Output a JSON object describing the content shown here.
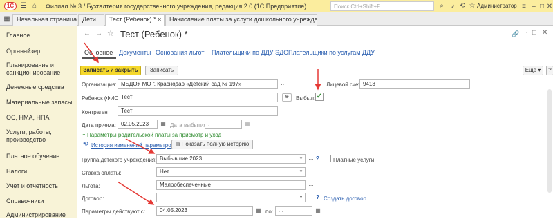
{
  "app": {
    "logo_text": "1С",
    "title": "Филиал № 3 / Бухгалтерия государственного учреждения, редакция 2.0  (1С:Предприятие)",
    "search_placeholder": "Поиск Ctrl+Shift+F",
    "user_name": "Администратор"
  },
  "tabs": [
    {
      "label": "Начальная страница"
    },
    {
      "label": "Дети"
    },
    {
      "label": "Тест (Ребенок) *"
    },
    {
      "label": "Начисление платы за услуги дошкольного учреждения"
    }
  ],
  "sidebar": {
    "items": [
      {
        "label": "Главное"
      },
      {
        "label": "Органайзер"
      },
      {
        "label": "Планирование и санкционирование"
      },
      {
        "label": "Денежные средства"
      },
      {
        "label": "Материальные запасы"
      },
      {
        "label": "ОС, НМА, НПА"
      },
      {
        "label": "Услуги, работы, производство"
      },
      {
        "label": "Платное обучение"
      },
      {
        "label": "Налоги"
      },
      {
        "label": "Учет и отчетность"
      },
      {
        "label": "Справочники"
      },
      {
        "label": "Администрирование"
      }
    ]
  },
  "form": {
    "title": "Тест (Ребенок) *",
    "subtabs": [
      {
        "label": "Основное"
      },
      {
        "label": "Документы"
      },
      {
        "label": "Основания льгот"
      },
      {
        "label": "Плательщики по ДДУ ЭДО"
      },
      {
        "label": "Плательщики по услугам ДДУ"
      }
    ],
    "save_close": "Записать и закрыть",
    "save": "Записать",
    "more": "Еще",
    "help": "?",
    "org_label": "Организация:",
    "org_value": "МБДОУ  МО г. Краснодар «Детский сад № 197»",
    "account_label": "Лицевой счет:",
    "account_value": "9413",
    "child_label": "Ребенок (ФИО):",
    "child_value": "Тест",
    "left_label": "Выбыл:",
    "contractor_label": "Контрагент:",
    "contractor_value": "Тест",
    "admission_label": "Дата приема:",
    "admission_value": "02.05.2023",
    "leave_label": "Дата выбытия:",
    "leave_value": ".  .",
    "params_header": "Параметры родительской платы за присмотр и уход",
    "history_link": "История изменений параметров",
    "history_btn": "Показать полную историю",
    "group_label": "Группа детского учреждения:",
    "group_value": "Выбывшие 2023",
    "paid_label": "Платные услуги",
    "rate_label": "Ставка оплаты:",
    "rate_value": "Нет",
    "benefit_label": "Льгота:",
    "benefit_value": "Малообеспеченные",
    "contract_label": "Договор:",
    "contract_value": "",
    "create_contract": "Создать договор",
    "params_from_label": "Параметры действуют с:",
    "params_from_value": "04.05.2023",
    "params_to_label": "по:",
    "params_to_value": ".  ."
  },
  "colors": {
    "accent": "#f5d82c",
    "link": "#2b5fb0",
    "arrow": "#e53935",
    "check": "#2e8b2e"
  }
}
